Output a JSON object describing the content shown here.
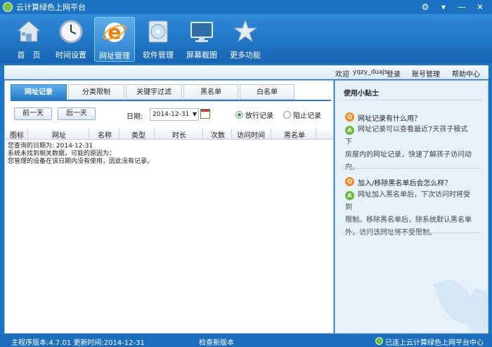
{
  "window": {
    "title": "云计算绿色上网平台"
  },
  "toolbar": {
    "items": [
      {
        "label": "首　页"
      },
      {
        "label": "时间设置"
      },
      {
        "label": "网址管理"
      },
      {
        "label": "软件管理"
      },
      {
        "label": "屏幕截图"
      },
      {
        "label": "更多功能"
      }
    ]
  },
  "userbar": {
    "welcome": "欢迎",
    "username": "yqzy_duajs",
    "login": "登录",
    "account": "账号管理",
    "help": "帮助中心"
  },
  "tabs": [
    "网址记录",
    "分类限制",
    "关键字过滤",
    "黑名单",
    "白名单"
  ],
  "controls": {
    "prev_day": "前一天",
    "next_day": "后一天",
    "date_label": "日期:",
    "date_value": "2014-12-31",
    "radio_allow": "放行记录",
    "radio_block": "阻止记录"
  },
  "table": {
    "headers": [
      "图标",
      "网址",
      "名称",
      "类型",
      "时长",
      "次数",
      "访问时间",
      "黑名单"
    ],
    "lines": [
      "您查询的日期为:  2014-12-31",
      "系统未找到相关数据，可能的原因为：",
      "您管理的设备在该日期内没有使用，因此没有记录。"
    ]
  },
  "tips": {
    "title": "使用小贴士",
    "items": [
      {
        "q": "网址记录有什么用？",
        "a_lines": [
          "网址记录可以查看最近7天孩子模式下",
          "房屋内的网址记录，快速了解孩子访问动",
          "向。"
        ]
      },
      {
        "q": "加入/移除黑名单后会怎么样？",
        "a_lines": [
          "网址加入黑名单后，下次访问时将受到",
          "限制。移除黑名单后，除系统默认黑名单",
          "外，访问该网址将不受限制。"
        ]
      }
    ]
  },
  "status": {
    "version": "主程序版本:4.7.01 更新时间:2014-12-31",
    "check_update": "检查新版本",
    "connected": "已连上云计算绿色上网平台中心"
  },
  "colors": {
    "titlebar": "#1b72c2",
    "accent": "#2a7bc9",
    "ok": "#6dbb3b"
  }
}
